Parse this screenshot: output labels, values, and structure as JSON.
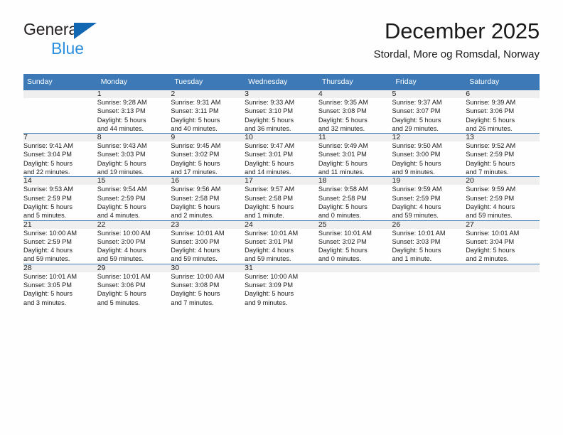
{
  "logo": {
    "line1": "General",
    "line2": "Blue"
  },
  "header": {
    "title": "December 2025",
    "subtitle": "Stordal, More og Romsdal, Norway"
  },
  "weekday_headers": [
    "Sunday",
    "Monday",
    "Tuesday",
    "Wednesday",
    "Thursday",
    "Friday",
    "Saturday"
  ],
  "colors": {
    "header_blue": "#3d79b6",
    "daynum_gray": "#efefef",
    "logo_blue": "#1267b2",
    "logo_text_blue": "#2b8ede"
  },
  "weeks": [
    [
      {
        "day": "",
        "lines": []
      },
      {
        "day": "1",
        "lines": [
          "Sunrise: 9:28 AM",
          "Sunset: 3:13 PM",
          "Daylight: 5 hours",
          "and 44 minutes."
        ]
      },
      {
        "day": "2",
        "lines": [
          "Sunrise: 9:31 AM",
          "Sunset: 3:11 PM",
          "Daylight: 5 hours",
          "and 40 minutes."
        ]
      },
      {
        "day": "3",
        "lines": [
          "Sunrise: 9:33 AM",
          "Sunset: 3:10 PM",
          "Daylight: 5 hours",
          "and 36 minutes."
        ]
      },
      {
        "day": "4",
        "lines": [
          "Sunrise: 9:35 AM",
          "Sunset: 3:08 PM",
          "Daylight: 5 hours",
          "and 32 minutes."
        ]
      },
      {
        "day": "5",
        "lines": [
          "Sunrise: 9:37 AM",
          "Sunset: 3:07 PM",
          "Daylight: 5 hours",
          "and 29 minutes."
        ]
      },
      {
        "day": "6",
        "lines": [
          "Sunrise: 9:39 AM",
          "Sunset: 3:06 PM",
          "Daylight: 5 hours",
          "and 26 minutes."
        ]
      }
    ],
    [
      {
        "day": "7",
        "lines": [
          "Sunrise: 9:41 AM",
          "Sunset: 3:04 PM",
          "Daylight: 5 hours",
          "and 22 minutes."
        ]
      },
      {
        "day": "8",
        "lines": [
          "Sunrise: 9:43 AM",
          "Sunset: 3:03 PM",
          "Daylight: 5 hours",
          "and 19 minutes."
        ]
      },
      {
        "day": "9",
        "lines": [
          "Sunrise: 9:45 AM",
          "Sunset: 3:02 PM",
          "Daylight: 5 hours",
          "and 17 minutes."
        ]
      },
      {
        "day": "10",
        "lines": [
          "Sunrise: 9:47 AM",
          "Sunset: 3:01 PM",
          "Daylight: 5 hours",
          "and 14 minutes."
        ]
      },
      {
        "day": "11",
        "lines": [
          "Sunrise: 9:49 AM",
          "Sunset: 3:01 PM",
          "Daylight: 5 hours",
          "and 11 minutes."
        ]
      },
      {
        "day": "12",
        "lines": [
          "Sunrise: 9:50 AM",
          "Sunset: 3:00 PM",
          "Daylight: 5 hours",
          "and 9 minutes."
        ]
      },
      {
        "day": "13",
        "lines": [
          "Sunrise: 9:52 AM",
          "Sunset: 2:59 PM",
          "Daylight: 5 hours",
          "and 7 minutes."
        ]
      }
    ],
    [
      {
        "day": "14",
        "lines": [
          "Sunrise: 9:53 AM",
          "Sunset: 2:59 PM",
          "Daylight: 5 hours",
          "and 5 minutes."
        ]
      },
      {
        "day": "15",
        "lines": [
          "Sunrise: 9:54 AM",
          "Sunset: 2:59 PM",
          "Daylight: 5 hours",
          "and 4 minutes."
        ]
      },
      {
        "day": "16",
        "lines": [
          "Sunrise: 9:56 AM",
          "Sunset: 2:58 PM",
          "Daylight: 5 hours",
          "and 2 minutes."
        ]
      },
      {
        "day": "17",
        "lines": [
          "Sunrise: 9:57 AM",
          "Sunset: 2:58 PM",
          "Daylight: 5 hours",
          "and 1 minute."
        ]
      },
      {
        "day": "18",
        "lines": [
          "Sunrise: 9:58 AM",
          "Sunset: 2:58 PM",
          "Daylight: 5 hours",
          "and 0 minutes."
        ]
      },
      {
        "day": "19",
        "lines": [
          "Sunrise: 9:59 AM",
          "Sunset: 2:59 PM",
          "Daylight: 4 hours",
          "and 59 minutes."
        ]
      },
      {
        "day": "20",
        "lines": [
          "Sunrise: 9:59 AM",
          "Sunset: 2:59 PM",
          "Daylight: 4 hours",
          "and 59 minutes."
        ]
      }
    ],
    [
      {
        "day": "21",
        "lines": [
          "Sunrise: 10:00 AM",
          "Sunset: 2:59 PM",
          "Daylight: 4 hours",
          "and 59 minutes."
        ]
      },
      {
        "day": "22",
        "lines": [
          "Sunrise: 10:00 AM",
          "Sunset: 3:00 PM",
          "Daylight: 4 hours",
          "and 59 minutes."
        ]
      },
      {
        "day": "23",
        "lines": [
          "Sunrise: 10:01 AM",
          "Sunset: 3:00 PM",
          "Daylight: 4 hours",
          "and 59 minutes."
        ]
      },
      {
        "day": "24",
        "lines": [
          "Sunrise: 10:01 AM",
          "Sunset: 3:01 PM",
          "Daylight: 4 hours",
          "and 59 minutes."
        ]
      },
      {
        "day": "25",
        "lines": [
          "Sunrise: 10:01 AM",
          "Sunset: 3:02 PM",
          "Daylight: 5 hours",
          "and 0 minutes."
        ]
      },
      {
        "day": "26",
        "lines": [
          "Sunrise: 10:01 AM",
          "Sunset: 3:03 PM",
          "Daylight: 5 hours",
          "and 1 minute."
        ]
      },
      {
        "day": "27",
        "lines": [
          "Sunrise: 10:01 AM",
          "Sunset: 3:04 PM",
          "Daylight: 5 hours",
          "and 2 minutes."
        ]
      }
    ],
    [
      {
        "day": "28",
        "lines": [
          "Sunrise: 10:01 AM",
          "Sunset: 3:05 PM",
          "Daylight: 5 hours",
          "and 3 minutes."
        ]
      },
      {
        "day": "29",
        "lines": [
          "Sunrise: 10:01 AM",
          "Sunset: 3:06 PM",
          "Daylight: 5 hours",
          "and 5 minutes."
        ]
      },
      {
        "day": "30",
        "lines": [
          "Sunrise: 10:00 AM",
          "Sunset: 3:08 PM",
          "Daylight: 5 hours",
          "and 7 minutes."
        ]
      },
      {
        "day": "31",
        "lines": [
          "Sunrise: 10:00 AM",
          "Sunset: 3:09 PM",
          "Daylight: 5 hours",
          "and 9 minutes."
        ]
      },
      {
        "day": "",
        "lines": []
      },
      {
        "day": "",
        "lines": []
      },
      {
        "day": "",
        "lines": []
      }
    ]
  ]
}
